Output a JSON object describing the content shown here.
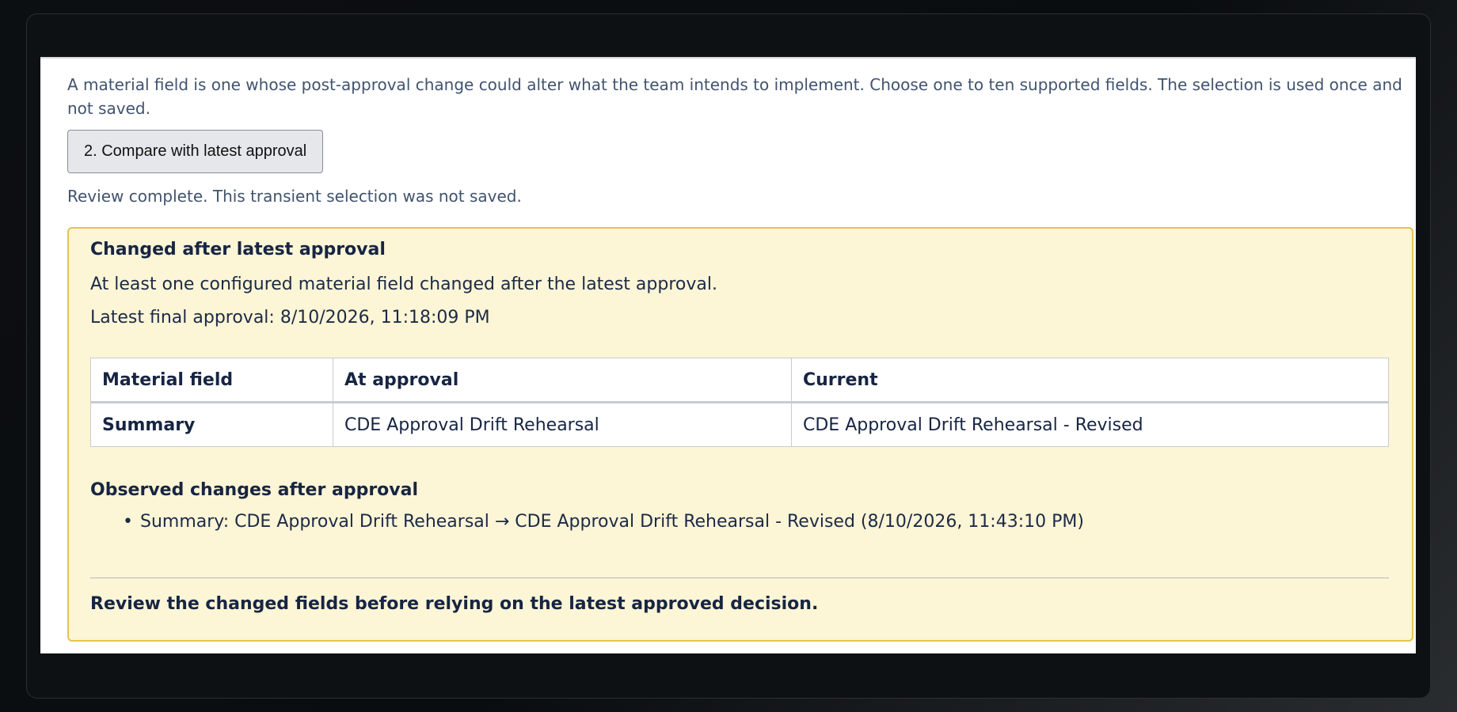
{
  "intro_text": "A material field is one whose post-approval change could alter what the team intends to implement. Choose one to ten supported fields. The selection is used once and not saved.",
  "compare_button_label": "2. Compare with latest approval",
  "status_text": "Review complete. This transient selection was not saved.",
  "drift": {
    "heading": "Changed after latest approval",
    "message": "At least one configured material field changed after the latest approval.",
    "latest_approval_label": "Latest final approval:",
    "latest_approval_value": "8/10/2026, 11:18:09 PM",
    "table": {
      "headers": [
        "Material field",
        "At approval",
        "Current"
      ],
      "rows": [
        [
          "Summary",
          "CDE Approval Drift Rehearsal",
          "CDE Approval Drift Rehearsal - Revised"
        ]
      ]
    },
    "observed_heading": "Observed changes after approval",
    "observed_changes": [
      "Summary: CDE Approval Drift Rehearsal → CDE Approval Drift Rehearsal - Revised (8/10/2026, 11:43:10 PM)"
    ],
    "advice": "Review the changed fields before relying on the latest approved decision."
  }
}
